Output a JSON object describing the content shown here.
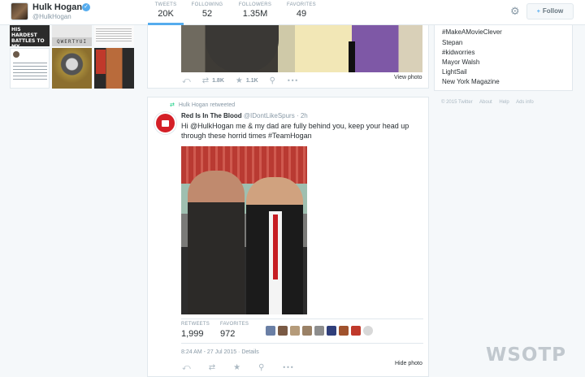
{
  "profile": {
    "name": "Hulk Hogan",
    "handle": "@HulkHogan",
    "verified_glyph": "✓"
  },
  "nav_stats": [
    {
      "label": "TWEETS",
      "value": "20K"
    },
    {
      "label": "FOLLOWING",
      "value": "52"
    },
    {
      "label": "FOLLOWERS",
      "value": "1.35M"
    },
    {
      "label": "FAVORITES",
      "value": "49"
    }
  ],
  "follow_button": {
    "label": "Follow"
  },
  "photo_grid": {
    "thumb1_text": "HIS HARDEST BATTLES TO MY STRONGEST SOLDIERS",
    "thumb2_text": "QWERTYUI ASDFGHJ"
  },
  "top_tweet": {
    "retweets": "1.8K",
    "favorites": "1.1K",
    "view_photo": "View photo"
  },
  "tweet": {
    "retweeted_by": "Hulk Hogan retweeted",
    "author_name": "Red Is In The Blood",
    "author_handle": "@IDontLikeSpurs",
    "time": "· 2h",
    "text": "Hi @HulkHogan me & my dad are fully behind you, keep your head up through these horrid times #TeamHogan",
    "retweets_label": "RETWEETS",
    "retweets_count": "1,999",
    "favorites_label": "FAVORITES",
    "favorites_count": "972",
    "date": "8:24 AM - 27 Jul 2015 · Details",
    "hide_photo": "Hide photo"
  },
  "trends": [
    "#MakeAMovieClever",
    "Stepan",
    "#kidworries",
    "Mayor Walsh",
    "LightSail",
    "New York Magazine"
  ],
  "footer": [
    "© 2015 Twitter",
    "About",
    "Help",
    "Ads info"
  ],
  "watermark": "WSOTP",
  "icons": {
    "reply": "⤺",
    "retweet": "⇄",
    "favorite": "★",
    "follow": "👤",
    "more": "•••",
    "gear": "⚙"
  },
  "colors": {
    "accent": "#55acee",
    "retweet_green": "#19cf86",
    "text": "#292f33",
    "muted": "#8899a6"
  }
}
